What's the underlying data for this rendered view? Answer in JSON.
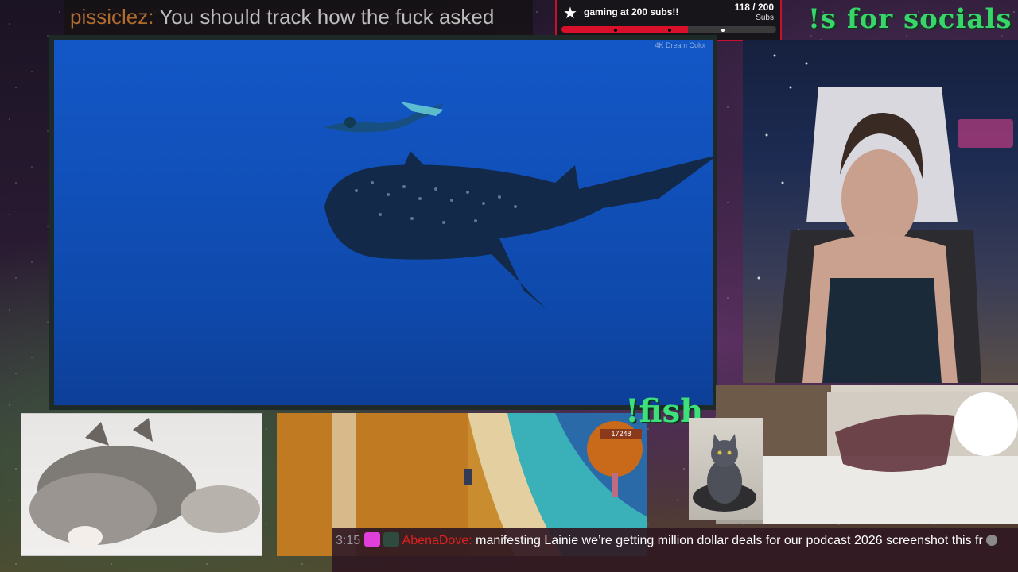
{
  "top_chat": {
    "username": "pissiclez:",
    "message": "You should track how the fuck asked"
  },
  "sub_goal": {
    "star_icon": "star-icon",
    "title": "gaming at 200 subs!!",
    "count": "118 / 200",
    "unit": "Subs",
    "progress_fraction": 0.59,
    "color": "#d8102a"
  },
  "socials": {
    "text": "!s for socials :)"
  },
  "video": {
    "watermark": "4K Dream Color"
  },
  "fish": {
    "text": "!fish"
  },
  "game": {
    "money": "17248"
  },
  "bottom_chat": {
    "time": "3:15",
    "username": "AbenaDove:",
    "message": "manifesting Lainie we’re getting million dollar deals for our podcast 2026 screenshot this fr",
    "username_color": "#e02020"
  }
}
